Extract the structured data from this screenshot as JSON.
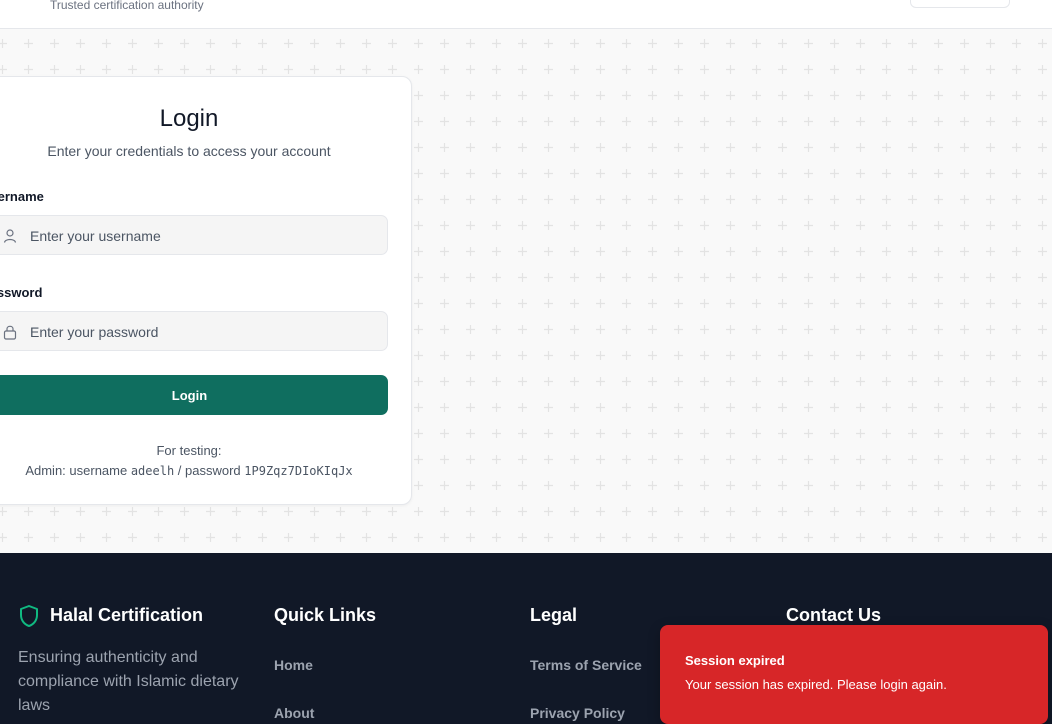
{
  "header": {
    "tagline": "Trusted certification authority"
  },
  "login": {
    "title": "Login",
    "subtitle": "Enter your credentials to access your account",
    "username_label": "Username",
    "username_placeholder": "Enter your username",
    "password_label": "Password",
    "password_placeholder": "Enter your password",
    "submit_label": "Login",
    "testing_title": "For testing:",
    "testing_admin_prefix": "Admin: username ",
    "testing_username": "adeelh",
    "testing_sep": " / password ",
    "testing_password": "1P9Zqz7DIoKIqJx"
  },
  "footer": {
    "brand_title": "Halal Certification",
    "brand_desc": "Ensuring authenticity and compliance with Islamic dietary laws",
    "quick_links_title": "Quick Links",
    "quick_links": [
      "Home",
      "About"
    ],
    "legal_title": "Legal",
    "legal_links": [
      "Terms of Service",
      "Privacy Policy"
    ],
    "contact_title": "Contact Us"
  },
  "toast": {
    "title": "Session expired",
    "message": "Your session has expired. Please login again."
  },
  "colors": {
    "primary": "#0f6e5f",
    "footer_bg": "#111827",
    "toast_bg": "#d72628"
  },
  "icons": {
    "username": "user-icon",
    "password": "lock-icon",
    "brand": "shield-icon"
  }
}
